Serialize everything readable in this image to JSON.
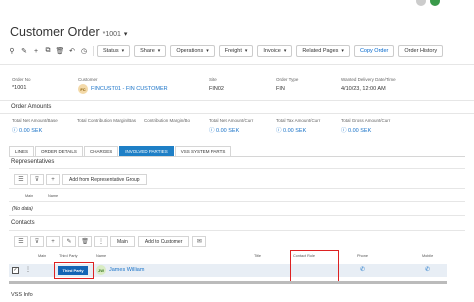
{
  "colors": {
    "accent": "#1e7fc6",
    "link": "#1a73c8",
    "highlight": "#d22222"
  },
  "header": {
    "title": "Customer Order",
    "order_no": "*1001",
    "caret": "▾"
  },
  "toolbar": {
    "icons": [
      "paperclip-icon",
      "pencil-icon",
      "plus-icon",
      "copy-icon",
      "trash-icon",
      "undo-icon",
      "clock-icon"
    ],
    "buttons": [
      {
        "label": "Status",
        "dropdown": true
      },
      {
        "label": "Share",
        "dropdown": true
      },
      {
        "label": "Operations",
        "dropdown": true
      },
      {
        "label": "Freight",
        "dropdown": true
      },
      {
        "label": "Invoice",
        "dropdown": true
      },
      {
        "label": "Related Pages",
        "dropdown": true
      },
      {
        "label": "Copy Order",
        "dropdown": false
      },
      {
        "label": "Order History",
        "dropdown": false
      }
    ]
  },
  "order": {
    "order_no_label": "Order No",
    "order_no": "*1001",
    "customer_label": "Customer",
    "customer_initials": "FC",
    "customer": "FINCUST01 - FIN CUSTOMER",
    "site_label": "Site",
    "site": "FIN02",
    "order_type_label": "Order Type",
    "order_type": "FIN",
    "wanted_label": "Wanted Delivery Date/Time",
    "wanted": "4/10/23, 12:00 AM"
  },
  "amounts": {
    "title": "Order Amounts",
    "items": [
      {
        "label": "Total Net Amount/Base",
        "value": "0.00 SEK"
      },
      {
        "label": "Total Contribution Margin/Bas",
        "value": ""
      },
      {
        "label": "Contribution Margin/Bo",
        "value": ""
      },
      {
        "label": "Total Net Amount/Curr",
        "value": "0.00 SEK"
      },
      {
        "label": "Total Tax Amount/Curr",
        "value": "0.00 SEK"
      },
      {
        "label": "Total Gross Amount/Curr",
        "value": "0.00 SEK"
      }
    ]
  },
  "tabs": [
    "LINES",
    "ORDER DETAILS",
    "CHARGES",
    "INVOLVED PARTIES",
    "VSS SYSTEM PARTS"
  ],
  "active_tab": 3,
  "representatives": {
    "title": "Representatives",
    "add_button": "Add from Representative Group",
    "col_main": "Main",
    "col_name": "Name",
    "empty": "(No data)"
  },
  "contacts": {
    "title": "Contacts",
    "main_button": "Main",
    "add_button": "Add to Customer",
    "columns": {
      "main": "Main",
      "third_party": "Third Party",
      "name": "Name",
      "title": "Title",
      "contact_role": "Contact Role",
      "phone": "Phone",
      "mobile": "Mobile"
    },
    "row": {
      "third_party": "Third Party",
      "initials": "JW",
      "name": "James William"
    }
  },
  "footer": {
    "vss_info": "VSS Info"
  }
}
